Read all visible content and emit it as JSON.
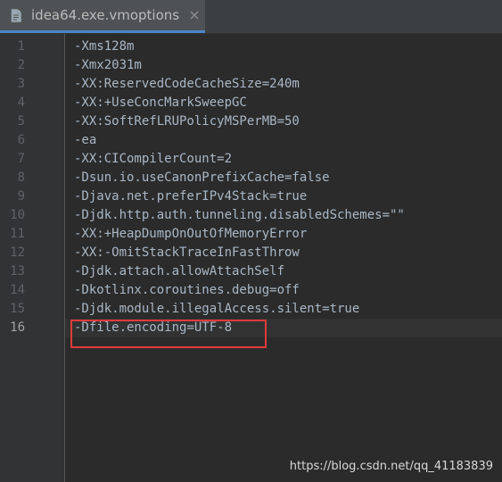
{
  "tab": {
    "title": "idea64.exe.vmoptions",
    "icon": "file-icon",
    "accent": "#4a88c7"
  },
  "editor": {
    "current_line": 16,
    "lines": [
      {
        "no": "1",
        "text": "-Xms128m"
      },
      {
        "no": "2",
        "text": "-Xmx2031m"
      },
      {
        "no": "3",
        "text": "-XX:ReservedCodeCacheSize=240m"
      },
      {
        "no": "4",
        "text": "-XX:+UseConcMarkSweepGC"
      },
      {
        "no": "5",
        "text": "-XX:SoftRefLRUPolicyMSPerMB=50"
      },
      {
        "no": "6",
        "text": "-ea"
      },
      {
        "no": "7",
        "text": "-XX:CICompilerCount=2"
      },
      {
        "no": "8",
        "text": "-Dsun.io.useCanonPrefixCache=false"
      },
      {
        "no": "9",
        "text": "-Djava.net.preferIPv4Stack=true"
      },
      {
        "no": "10",
        "text": "-Djdk.http.auth.tunneling.disabledSchemes=\"\""
      },
      {
        "no": "11",
        "text": "-XX:+HeapDumpOnOutOfMemoryError"
      },
      {
        "no": "12",
        "text": "-XX:-OmitStackTraceInFastThrow"
      },
      {
        "no": "13",
        "text": "-Djdk.attach.allowAttachSelf"
      },
      {
        "no": "14",
        "text": "-Dkotlinx.coroutines.debug=off"
      },
      {
        "no": "15",
        "text": "-Djdk.module.illegalAccess.silent=true"
      },
      {
        "no": "16",
        "text": "-Dfile.encoding=UTF-8"
      }
    ]
  },
  "annotation": {
    "highlight_color": "#e03b3b"
  },
  "watermark": "https://blog.csdn.net/qq_41183839"
}
